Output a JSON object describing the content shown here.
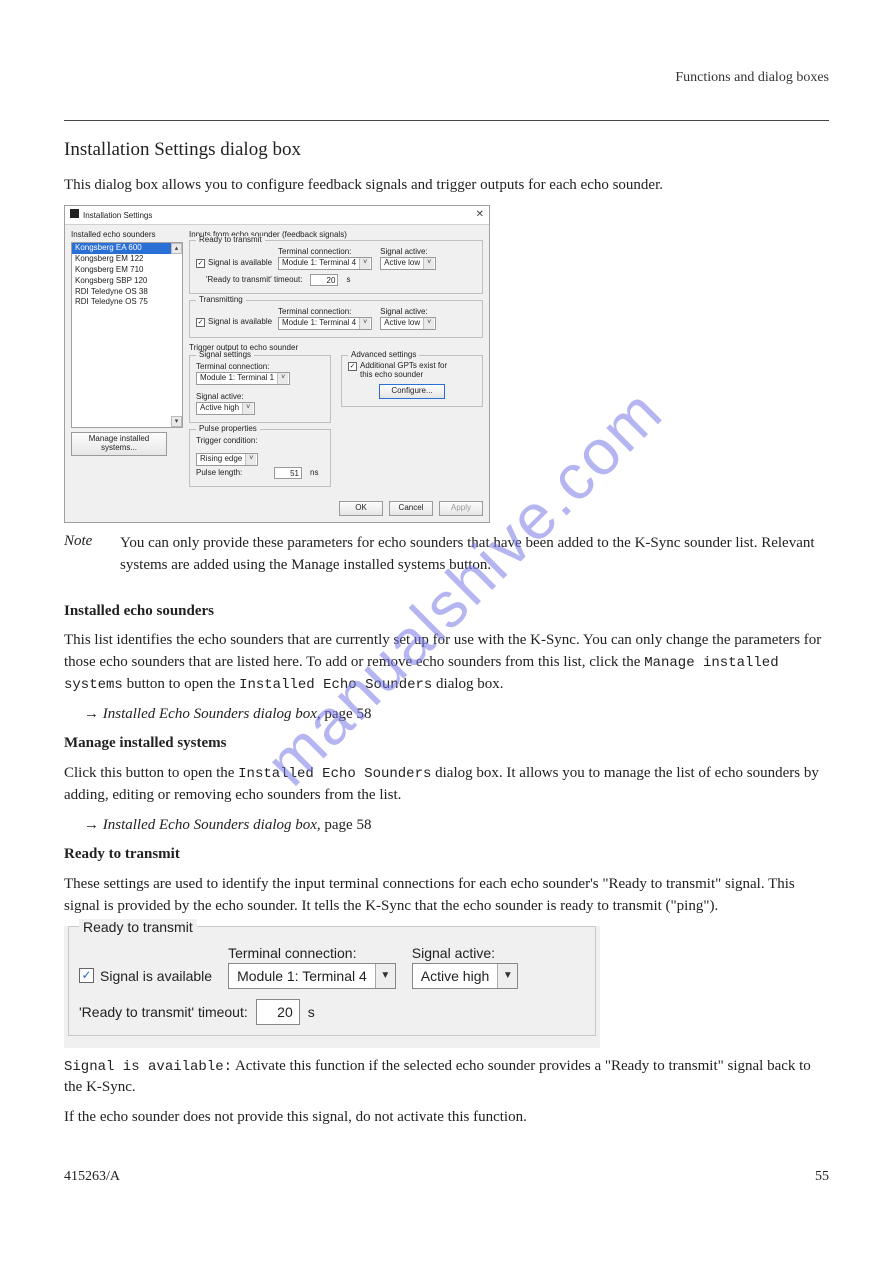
{
  "doc": {
    "section_title": "Installation Settings dialog box",
    "intro": "This dialog box allows you to configure feedback signals and trigger outputs for each echo sounder.",
    "note_label": "Note",
    "note_body": "You can only provide these parameters for echo sounders that have been added to the K-Sync sounder list. Relevant systems are added using the Manage installed systems button.",
    "installed_h": "Installed echo sounders",
    "installed_p": "This list identifies the echo sounders that are currently set up for use with the K-Sync. You can only change the parameters for those echo sounders that are listed here. To add or remove echo sounders from this list, click the Manage installed systems button to open the Installed Echo Sounders dialog box.",
    "related": "→ Installed Echo Sounders dialog box, page 58",
    "manage_h": "Manage installed systems",
    "manage_p": "Click this button to open the Installed Echo Sounders dialog box. It allows you to manage the list of echo sounders by adding, editing or removing echo sounders from the list.",
    "related2": "→ Installed Echo Sounders dialog box, page 58",
    "rtt_h": "Ready to transmit",
    "rtt_p": "These settings are used to identify the input terminal connections for each echo sounder's \"Ready to transmit\" signal. This signal is provided by the echo sounder. It tells the K-Sync that the echo sounder is ready to transmit (\"ping\").",
    "signal_label": "Signal is available:",
    "signal_body1": "Activate this function if the selected echo sounder provides a \"Ready to transmit\" signal back to the K-Sync.",
    "signal_body2": "If the echo sounder does not provide this signal, do not activate this function.",
    "page": "415263/A",
    "pagenum": "55"
  },
  "dlg": {
    "title": "Installation Settings",
    "close": "✕",
    "installed_label": "Installed echo sounders",
    "sounders": [
      "Kongsberg EA 600",
      "Kongsberg EM 122",
      "Kongsberg EM 710",
      "Kongsberg SBP 120",
      "RDI Teledyne OS 38",
      "RDI Teledyne OS 75"
    ],
    "manage_btn": "Manage installed systems...",
    "inputs_label": "Inputs from echo sounder (feedback signals)",
    "ready": {
      "caption": "Ready to transmit",
      "signal_cb": "Signal is available",
      "signal_checked": "✓",
      "term_lbl": "Terminal connection:",
      "term_val": "Module 1: Terminal 4",
      "sigact_lbl": "Signal active:",
      "sigact_val": "Active low",
      "timeout_lbl": "'Ready to transmit' timeout:",
      "timeout_val": "20",
      "timeout_unit": "s"
    },
    "trans": {
      "caption": "Transmitting",
      "signal_cb": "Signal is available",
      "signal_checked": "✓",
      "term_lbl": "Terminal connection:",
      "term_val": "Module 1: Terminal 4",
      "sigact_lbl": "Signal active:",
      "sigact_val": "Active low"
    },
    "trig_label": "Trigger output to echo sounder",
    "sigset": {
      "caption": "Signal settings",
      "term_lbl": "Terminal connection:",
      "term_val": "Module 1: Terminal 1",
      "sigact_lbl": "Signal active:",
      "sigact_val": "Active high"
    },
    "pulse": {
      "caption": "Pulse properties",
      "trigcond_lbl": "Trigger condition:",
      "trigcond_val": "Rising edge",
      "plen_lbl": "Pulse length:",
      "plen_val": "51",
      "plen_unit": "ns"
    },
    "adv": {
      "caption": "Advanced settings",
      "cb": "Additional GPTs exist for this echo sounder",
      "cb_checked": "✓",
      "btn": "Configure..."
    },
    "ok": "OK",
    "cancel": "Cancel",
    "apply": "Apply"
  },
  "panel2": {
    "caption": "Ready to transmit",
    "cb_label": "Signal is available",
    "cb_checked": "✓",
    "term_lbl": "Terminal connection:",
    "term_val": "Module 1: Terminal 4",
    "sigact_lbl": "Signal active:",
    "sigact_val": "Active high",
    "timeout_lbl": "'Ready to transmit' timeout:",
    "timeout_val": "20",
    "timeout_unit": "s"
  }
}
